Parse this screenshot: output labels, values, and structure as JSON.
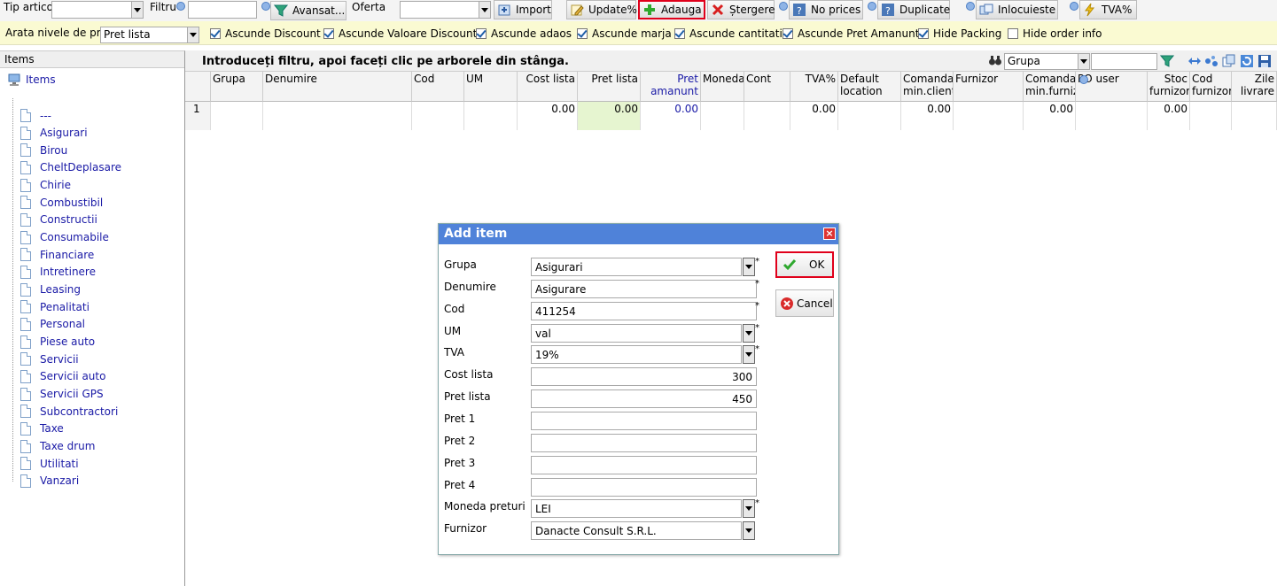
{
  "toolbar": {
    "tip_articol": "Tip articol",
    "filtru": "Filtru",
    "avansat": "Avansat...",
    "oferta": "Oferta",
    "import": "Import",
    "update": "Update%",
    "adauga": "Adauga",
    "stergere": "Ștergere",
    "no_prices": "No prices",
    "duplicate": "Duplicate",
    "inlocuieste": "Inlocuieste",
    "tva": "TVA%"
  },
  "level_bar": {
    "label": "Arata nivele de pret",
    "select_value": "Pret lista",
    "checkboxes": [
      {
        "label": "Ascunde Discount",
        "checked": true
      },
      {
        "label": "Ascunde Valoare Discount",
        "checked": true
      },
      {
        "label": "Ascunde adaos",
        "checked": true
      },
      {
        "label": "Ascunde marja",
        "checked": true
      },
      {
        "label": "Ascunde cantitati",
        "checked": true
      },
      {
        "label": "Ascunde Pret Amanunt",
        "checked": true
      },
      {
        "label": "Hide Packing",
        "checked": true
      },
      {
        "label": "Hide order info",
        "checked": false
      }
    ]
  },
  "left": {
    "header": "Items",
    "root": "Items",
    "items": [
      "---",
      "Asigurari",
      "Birou",
      "CheltDeplasare",
      "Chirie",
      "Combustibil",
      "Constructii",
      "Consumabile",
      "Financiare",
      "Intretinere",
      "Leasing",
      "Penalitati",
      "Personal",
      "Piese auto",
      "Servicii",
      "Servicii auto",
      "Servicii GPS",
      "Subcontractori",
      "Taxe",
      "Taxe drum",
      "Utilitati",
      "Vanzari"
    ]
  },
  "main": {
    "title": "Introduceți filtru, apoi faceți clic pe arborele din stânga.",
    "group_select": "Grupa",
    "columns": [
      "",
      "Grupa",
      "Denumire",
      "Cod",
      "UM",
      "Cost lista",
      "Pret lista",
      "Pret amanunt",
      "Moneda",
      "Cont",
      "TVA%",
      "Default location",
      "Comanda min.client",
      "Furnizor",
      "Comanda min.furnizor",
      "PO user",
      "Stoc furnizor",
      "Cod furnizor",
      "Zile livrare"
    ],
    "row": [
      "1",
      "",
      "",
      "",
      "",
      "0.00",
      "0.00",
      "0.00",
      "",
      "",
      "0.00",
      "",
      "0.00",
      "",
      "0.00",
      "",
      "0.00",
      "",
      ""
    ]
  },
  "dialog": {
    "title": "Add item",
    "fields": [
      {
        "label": "Grupa",
        "value": "Asigurari",
        "type": "select",
        "required": true
      },
      {
        "label": "Denumire",
        "value": "Asigurare",
        "type": "text",
        "required": true
      },
      {
        "label": "Cod",
        "value": "411254",
        "type": "text",
        "required": true
      },
      {
        "label": "UM",
        "value": "val",
        "type": "select",
        "required": true
      },
      {
        "label": "TVA",
        "value": "19%",
        "type": "select",
        "required": true
      },
      {
        "label": "Cost lista",
        "value": "300",
        "type": "number",
        "required": false
      },
      {
        "label": "Pret lista",
        "value": "450",
        "type": "number",
        "required": false
      },
      {
        "label": "Pret 1",
        "value": "",
        "type": "number",
        "required": false
      },
      {
        "label": "Pret 2",
        "value": "",
        "type": "number",
        "required": false
      },
      {
        "label": "Pret 3",
        "value": "",
        "type": "number",
        "required": false
      },
      {
        "label": "Pret 4",
        "value": "",
        "type": "number",
        "required": false
      },
      {
        "label": "Moneda preturi",
        "value": "LEI",
        "type": "select",
        "required": true
      },
      {
        "label": "Furnizor",
        "value": "Danacte Consult S.R.L.",
        "type": "select",
        "required": false
      }
    ],
    "ok": "OK",
    "cancel": "Cancel",
    "required_mark": "*"
  },
  "colors": {
    "highlight": "#e0001b",
    "title_bar": "#4f82d9",
    "link": "#1a1aa6",
    "price_col": "#e6f5d0"
  }
}
